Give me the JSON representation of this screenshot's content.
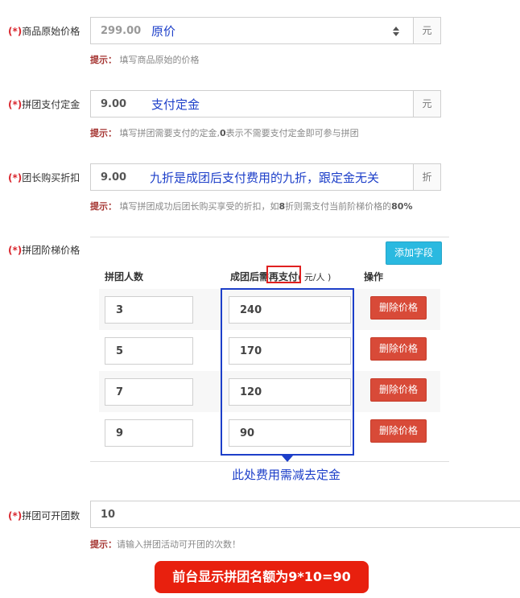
{
  "form": {
    "required_mark": "(*)",
    "original_price": {
      "label": "商品原始价格",
      "value": "299.00",
      "unit": "元",
      "annotation": "原价",
      "hint_label": "提示：",
      "hint_text": "填写商品原始的价格"
    },
    "deposit": {
      "label": "拼团支付定金",
      "value": "9.00",
      "unit": "元",
      "annotation": "支付定金",
      "hint_label": "提示：",
      "hint_text_1": "填写拼团需要支付的定金,",
      "hint_bold": "0",
      "hint_text_2": "表示不需要支付定金即可参与拼团"
    },
    "leader_discount": {
      "label": "团长购买折扣",
      "value": "9.00",
      "unit": "折",
      "annotation": "九折是成团后支付费用的九折，跟定金无关",
      "hint_label": "提示：",
      "hint_text_1": "填写拼团成功后团长购买享受的折扣，如",
      "hint_bold_1": "8",
      "hint_text_2": "折则需支付当前阶梯价格的",
      "hint_bold_2": "80%"
    },
    "tier_price": {
      "label": "拼团阶梯价格",
      "add_button": "添加字段",
      "columns": {
        "group_size": "拼团人数",
        "pay_prefix": "成团后需",
        "pay_highlight": "再支付",
        "pay_suffix": "( 元/人 )",
        "action": "操作"
      },
      "rows": [
        {
          "size": "3",
          "price": "240",
          "delete": "删除价格"
        },
        {
          "size": "5",
          "price": "170",
          "delete": "删除价格"
        },
        {
          "size": "7",
          "price": "120",
          "delete": "删除价格"
        },
        {
          "size": "9",
          "price": "90",
          "delete": "删除价格"
        }
      ],
      "annotation": "此处费用需减去定金"
    },
    "group_limit": {
      "label": "拼团可开团数",
      "value": "10",
      "hint_label": "提示：",
      "hint_text": "请输入拼团活动可开团的次数！"
    }
  },
  "bottom_note": "前台显示拼团名额为9*10=90",
  "colors": {
    "required": "#d9272e",
    "annotation_blue": "#1d3fc9",
    "add_button": "#2ab9e0",
    "delete_button": "#d84a38",
    "badge_red": "#e8200e"
  }
}
